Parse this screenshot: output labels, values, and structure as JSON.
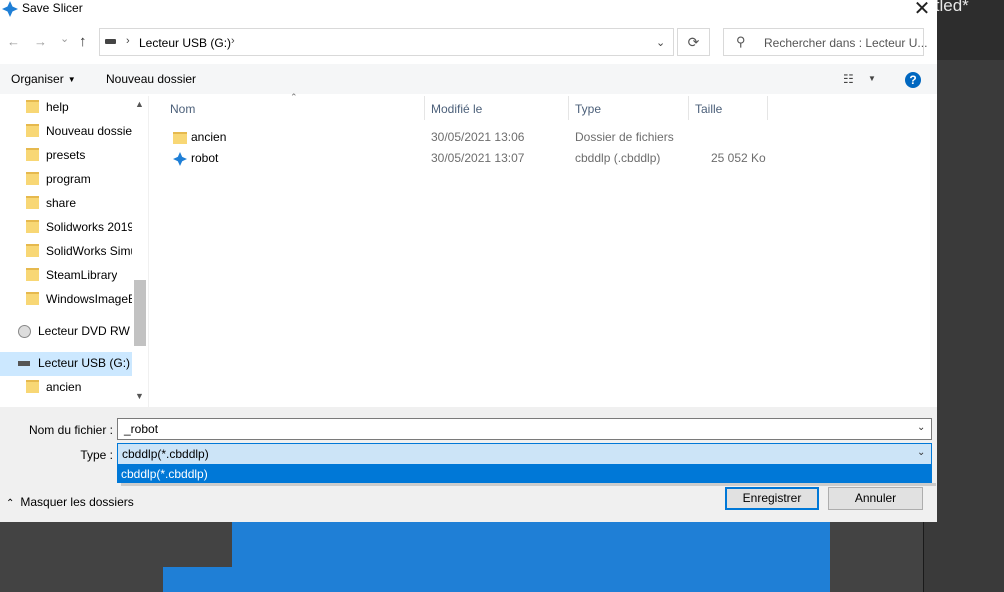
{
  "background_app": {
    "title_fragment": "itled*"
  },
  "dialog": {
    "title": "Save Slicer",
    "close_glyph": "✕"
  },
  "nav": {
    "back_glyph": "←",
    "forward_glyph": "→",
    "recent_glyph": "⌄",
    "up_glyph": "↑"
  },
  "address": {
    "path": "Lecteur USB (G:)",
    "separator": "›",
    "dropdown_glyph": "⌄",
    "refresh_glyph": "⟳"
  },
  "search": {
    "placeholder": "Rechercher dans : Lecteur U..."
  },
  "toolbar": {
    "organize_label": "Organiser",
    "new_folder_label": "Nouveau dossier",
    "help_label": "?"
  },
  "tree": {
    "items": [
      {
        "label": "help",
        "icon": "folder-icon"
      },
      {
        "label": "Nouveau dossier",
        "icon": "folder-icon"
      },
      {
        "label": "presets",
        "icon": "folder-icon"
      },
      {
        "label": "program",
        "icon": "folder-icon"
      },
      {
        "label": "share",
        "icon": "folder-icon"
      },
      {
        "label": "Solidworks 2019",
        "icon": "folder-icon"
      },
      {
        "label": "SolidWorks Simu",
        "icon": "folder-icon"
      },
      {
        "label": "SteamLibrary",
        "icon": "folder-icon"
      },
      {
        "label": "WindowsImageB",
        "icon": "folder-icon"
      },
      {
        "label": "Lecteur DVD RW (",
        "icon": "dvd-drive-icon"
      },
      {
        "label": "Lecteur USB (G:)",
        "icon": "usb-drive-icon",
        "selected": true
      },
      {
        "label": "ancien",
        "icon": "folder-icon"
      }
    ]
  },
  "columns": {
    "name": "Nom",
    "modified": "Modifié le",
    "type": "Type",
    "size": "Taille"
  },
  "files": [
    {
      "name": "ancien",
      "modified": "30/05/2021 13:06",
      "type": "Dossier de fichiers",
      "size": "",
      "icon": "folder-icon"
    },
    {
      "name": "robot",
      "modified": "30/05/2021 13:07",
      "type": "cbddlp (.cbddlp)",
      "size": "25 052 Ko",
      "icon": "slicer-file-icon"
    }
  ],
  "form": {
    "filename_label": "Nom du fichier :",
    "filename_value": "_robot",
    "type_label": "Type :",
    "type_value": "cbddlp(*.cbddlp)",
    "type_options": [
      "cbddlp(*.cbddlp)"
    ]
  },
  "footer": {
    "hide_folders_label": "Masquer les dossiers",
    "save_label": "Enregistrer",
    "cancel_label": "Annuler"
  },
  "colors": {
    "accent": "#0078d7",
    "selection": "#cce8ff",
    "folder": "#f8d775",
    "model": "#1f7fd6"
  }
}
